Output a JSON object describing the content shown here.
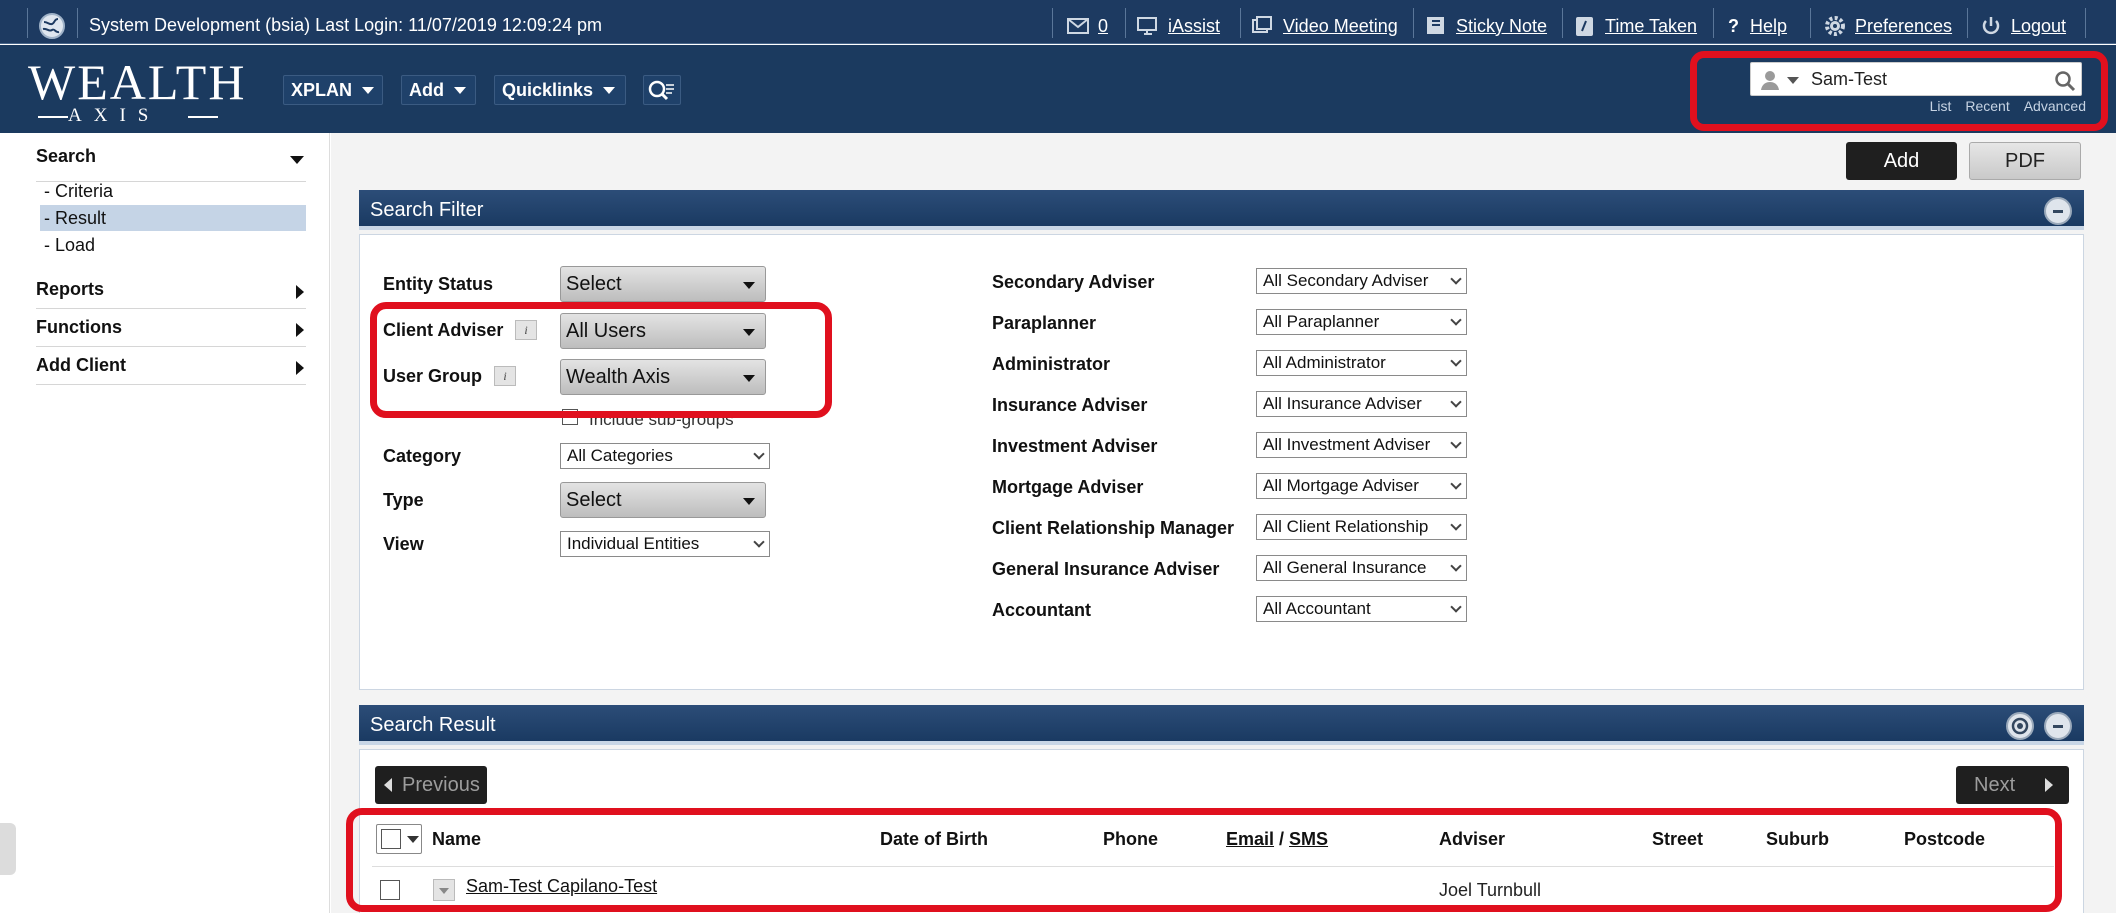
{
  "topbar": {
    "system_info": "System Development (bsia) Last Login: 11/07/2019 12:09:24 pm",
    "mail_count": "0",
    "iassist": "iAssist",
    "video_meeting": "Video Meeting",
    "sticky_note": "Sticky Note",
    "time_taken": "Time Taken",
    "help": "Help",
    "preferences": "Preferences",
    "logout": "Logout"
  },
  "header": {
    "logo_top": "WEALTH",
    "logo_bottom": "AXIS",
    "nav": {
      "xplan": "XPLAN",
      "add": "Add",
      "quicklinks": "Quicklinks"
    },
    "search": {
      "value": "Sam-Test",
      "links": [
        "List",
        "Recent",
        "Advanced"
      ]
    }
  },
  "sidebar": {
    "search": "Search",
    "search_items": [
      "- Criteria",
      "- Result",
      "- Load"
    ],
    "active_index": 1,
    "reports": "Reports",
    "functions": "Functions",
    "add_client": "Add Client"
  },
  "toolbar": {
    "add": "Add",
    "pdf": "PDF"
  },
  "filter": {
    "title": "Search Filter",
    "left": {
      "entity_status": {
        "label": "Entity Status",
        "value": "Select"
      },
      "client_adviser": {
        "label": "Client Adviser",
        "value": "All Users"
      },
      "user_group": {
        "label": "User Group",
        "value": "Wealth Axis"
      },
      "include_sub_groups": "Include sub-groups",
      "category": {
        "label": "Category",
        "value": "All Categories"
      },
      "type": {
        "label": "Type",
        "value": "Select"
      },
      "view": {
        "label": "View",
        "value": "Individual Entities"
      }
    },
    "right": [
      {
        "label": "Secondary Adviser",
        "value": "All Secondary Adviser"
      },
      {
        "label": "Paraplanner",
        "value": "All Paraplanner"
      },
      {
        "label": "Administrator",
        "value": "All Administrator"
      },
      {
        "label": "Insurance Adviser",
        "value": "All Insurance Adviser"
      },
      {
        "label": "Investment Adviser",
        "value": "All Investment Adviser"
      },
      {
        "label": "Mortgage Adviser",
        "value": "All Mortgage Adviser"
      },
      {
        "label": "Client Relationship Manager",
        "value": "All Client Relationship"
      },
      {
        "label": "General Insurance Adviser",
        "value": "All General Insurance"
      },
      {
        "label": "Accountant",
        "value": "All Accountant"
      }
    ]
  },
  "result": {
    "title": "Search Result",
    "previous": "Previous",
    "next": "Next",
    "columns": {
      "name": "Name",
      "dob": "Date of Birth",
      "phone": "Phone",
      "email": "Email",
      "slash": " / ",
      "sms": "SMS",
      "adviser": "Adviser",
      "street": "Street",
      "suburb": "Suburb",
      "postcode": "Postcode"
    },
    "rows": [
      {
        "name": "Sam-Test Capilano-Test",
        "adviser": "Joel Turnbull"
      }
    ]
  },
  "colors": {
    "navy": "#1b3a5f",
    "highlight_red": "#e0101e",
    "active_nav": "#c5d4e6"
  }
}
